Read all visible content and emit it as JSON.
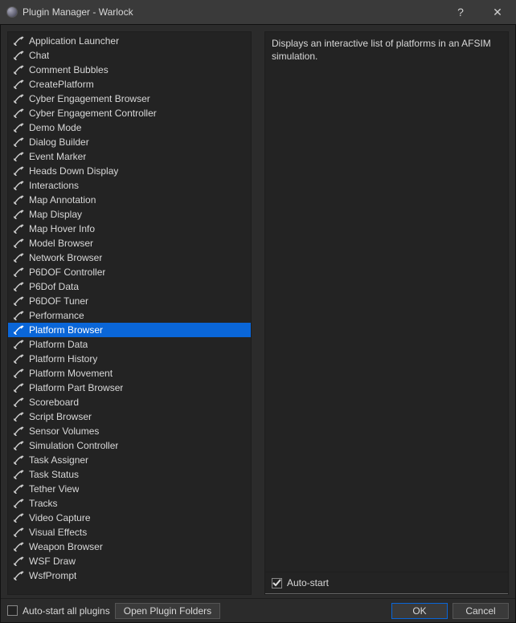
{
  "window": {
    "title": "Plugin Manager - Warlock",
    "help_glyph": "?",
    "close_glyph": "✕"
  },
  "plugins": [
    {
      "label": "Application Launcher"
    },
    {
      "label": "Chat"
    },
    {
      "label": "Comment Bubbles"
    },
    {
      "label": "CreatePlatform"
    },
    {
      "label": "Cyber Engagement Browser"
    },
    {
      "label": "Cyber Engagement Controller"
    },
    {
      "label": "Demo Mode"
    },
    {
      "label": "Dialog Builder"
    },
    {
      "label": "Event Marker"
    },
    {
      "label": "Heads Down Display"
    },
    {
      "label": "Interactions"
    },
    {
      "label": "Map Annotation"
    },
    {
      "label": "Map Display"
    },
    {
      "label": "Map Hover Info"
    },
    {
      "label": "Model Browser"
    },
    {
      "label": "Network Browser"
    },
    {
      "label": "P6DOF Controller"
    },
    {
      "label": "P6Dof Data"
    },
    {
      "label": "P6DOF Tuner"
    },
    {
      "label": "Performance"
    },
    {
      "label": "Platform Browser",
      "selected": true
    },
    {
      "label": "Platform Data"
    },
    {
      "label": "Platform History"
    },
    {
      "label": "Platform Movement"
    },
    {
      "label": "Platform Part Browser"
    },
    {
      "label": "Scoreboard"
    },
    {
      "label": "Script Browser"
    },
    {
      "label": "Sensor Volumes"
    },
    {
      "label": "Simulation Controller"
    },
    {
      "label": "Task Assigner"
    },
    {
      "label": "Task Status"
    },
    {
      "label": "Tether View"
    },
    {
      "label": "Tracks"
    },
    {
      "label": "Video Capture"
    },
    {
      "label": "Visual Effects"
    },
    {
      "label": "Weapon Browser"
    },
    {
      "label": "WSF Draw"
    },
    {
      "label": "WsfPrompt"
    }
  ],
  "details": {
    "description": "Displays an interactive list of platforms in an AFSIM simulation.",
    "autostart_label": "Auto-start",
    "autostart_checked": true
  },
  "footer": {
    "autostart_all_label": "Auto-start all plugins",
    "autostart_all_checked": false,
    "open_folders_label": "Open Plugin Folders",
    "ok_label": "OK",
    "cancel_label": "Cancel"
  }
}
